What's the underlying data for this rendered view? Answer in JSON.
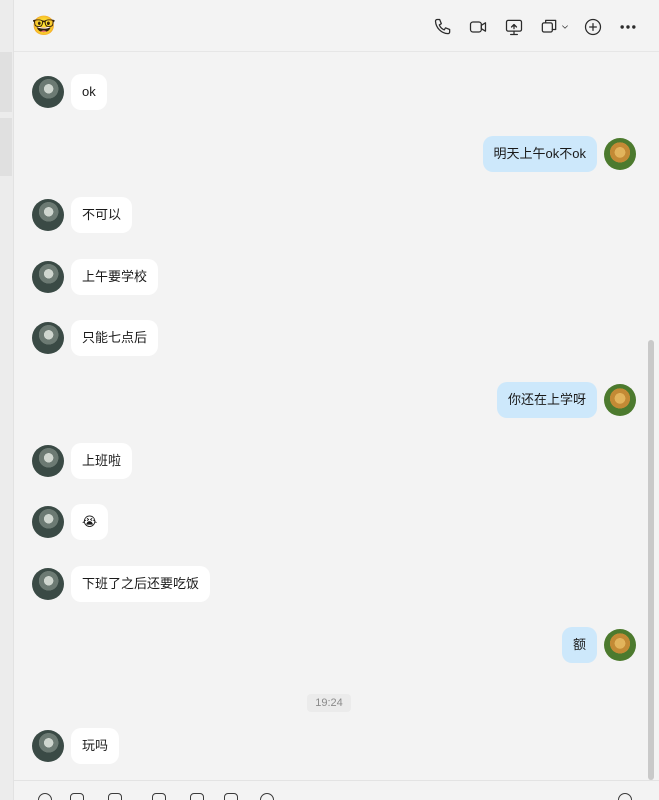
{
  "header": {
    "contact_emoji": "🤓",
    "tools": [
      "phone-icon",
      "video-call-icon",
      "screen-share-icon",
      "multi-window-icon",
      "add-circle-icon",
      "more-icon"
    ]
  },
  "messages": [
    {
      "side": "in",
      "text": "ok"
    },
    {
      "side": "out",
      "text": "明天上午ok不ok"
    },
    {
      "side": "in",
      "text": "不可以"
    },
    {
      "side": "in",
      "text": "上午要学校"
    },
    {
      "side": "in",
      "text": "只能七点后"
    },
    {
      "side": "out",
      "text": "你还在上学呀"
    },
    {
      "side": "in",
      "text": "上班啦"
    },
    {
      "side": "in",
      "text": "😭"
    },
    {
      "side": "in",
      "text": "下班了之后还要吃饭"
    },
    {
      "side": "out",
      "text": "额"
    },
    {
      "side": "in",
      "text": "玩吗"
    }
  ],
  "timestamp": "19:24",
  "colors": {
    "incoming_bubble": "#ffffff",
    "outgoing_bubble": "#cde8fb",
    "background": "#f3f3f3"
  }
}
